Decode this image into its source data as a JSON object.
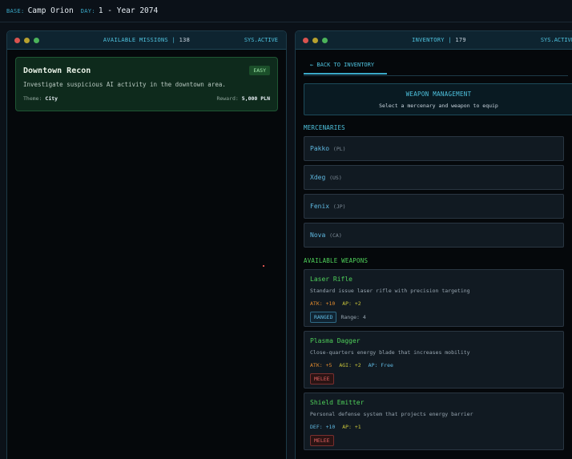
{
  "topbar": {
    "base_key": "BASE:",
    "base_val": "Camp Orion",
    "day_key": "DAY:",
    "day_val": "1 - Year 2074"
  },
  "missions_panel": {
    "title": "AVAILABLE MISSIONS |",
    "count": "138",
    "status": "SYS.ACTIVE",
    "missions": [
      {
        "title": "Downtown Recon",
        "difficulty": "EASY",
        "description": "Investigate suspicious AI activity in the downtown area.",
        "theme_label": "Theme:",
        "theme": "City",
        "reward_label": "Reward:",
        "reward": "5,000 PLN"
      }
    ]
  },
  "inventory_panel": {
    "title": "INVENTORY |",
    "count": "179",
    "status": "SYS.ACTIVE",
    "back_tab": "← BACK TO INVENTORY",
    "header": {
      "title": "WEAPON MANAGEMENT",
      "subtitle": "Select a mercenary and weapon to equip"
    },
    "mercenaries_label": "MERCENARIES",
    "mercenaries": [
      {
        "name": "Pakko",
        "country": "(PL)"
      },
      {
        "name": "Xdeg",
        "country": "(US)"
      },
      {
        "name": "Fenix",
        "country": "(JP)"
      },
      {
        "name": "Nova",
        "country": "(CA)"
      }
    ],
    "weapons_label": "AVAILABLE WEAPONS",
    "weapons": [
      {
        "name": "Laser Rifle",
        "description": "Standard issue laser rifle with precision targeting",
        "stat1": "ATK: +10",
        "stat2": "AP: +2",
        "tag": "RANGED",
        "range": "Range: 4"
      },
      {
        "name": "Plasma Dagger",
        "description": "Close-quarters energy blade that increases mobility",
        "stat1": "ATK: +5",
        "stat2": "AGI: +2",
        "stat3": "AP: Free",
        "tag": "MELEE"
      },
      {
        "name": "Shield Emitter",
        "description": "Personal defense system that projects energy barrier",
        "stat1": "DEF: +10",
        "stat2": "AP: +1",
        "tag": "MELEE"
      }
    ]
  },
  "colors": {
    "accent": "#4fc3df",
    "weapon_green": "#4fd05a",
    "mission_bg": "#0e2a1c"
  }
}
